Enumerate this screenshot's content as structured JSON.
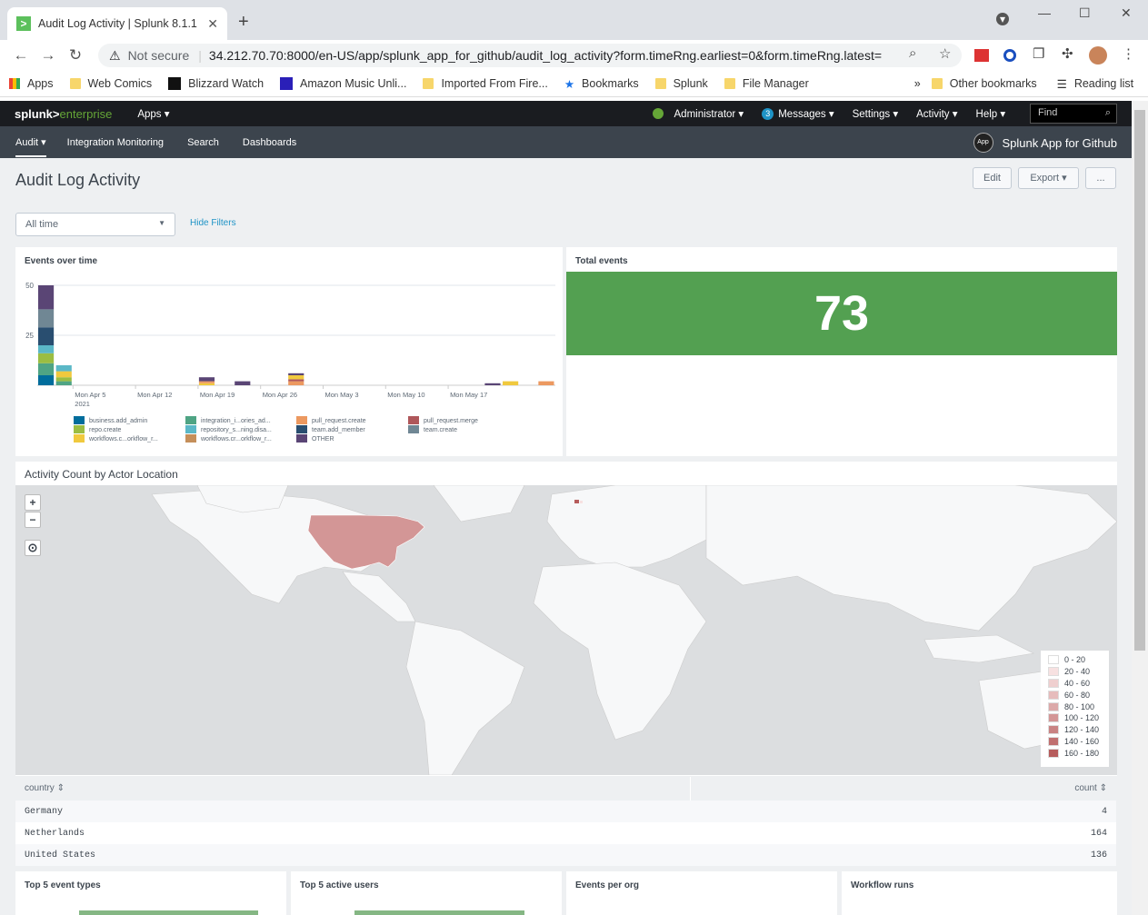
{
  "browser": {
    "tab_title": "Audit Log Activity | Splunk 8.1.1",
    "security": "Not secure",
    "url": "34.212.70.70:8000/en-US/app/splunk_app_for_github/audit_log_activity?form.timeRng.earliest=0&form.timeRng.latest=",
    "bookmarks": [
      "Apps",
      "Web Comics",
      "Blizzard Watch",
      "Amazon Music Unli...",
      "Imported From Fire...",
      "Bookmarks",
      "Splunk",
      "File Manager"
    ],
    "overflow": "»",
    "other_bookmarks": "Other bookmarks",
    "reading_list": "Reading list"
  },
  "splunk_bar": {
    "logo_a": "splunk>",
    "logo_b": "enterprise",
    "apps": "Apps ▾",
    "admin": "Administrator ▾",
    "messages_count": "3",
    "messages": "Messages ▾",
    "settings": "Settings ▾",
    "activity": "Activity ▾",
    "help": "Help ▾",
    "find": "Find"
  },
  "app_bar": {
    "items": [
      "Audit ▾",
      "Integration Monitoring",
      "Search",
      "Dashboards"
    ],
    "app_icon": "App",
    "app_name": "Splunk App for Github"
  },
  "dashboard": {
    "title": "Audit Log Activity",
    "edit": "Edit",
    "export": "Export ▾",
    "more": "...",
    "time_picker": "All time",
    "hide_filters": "Hide Filters"
  },
  "panels": {
    "events_over_time": "Events over time",
    "total_events": "Total events",
    "total_events_value": "73",
    "map_title": "Activity Count by Actor Location",
    "top5_types": "Top 5 event types",
    "top5_users": "Top 5 active users",
    "events_per_org": "Events per org",
    "workflow_runs": "Workflow runs"
  },
  "chart_data": {
    "type": "bar",
    "title": "Events over time",
    "ylim": [
      0,
      50
    ],
    "y_ticks": [
      "50",
      "25"
    ],
    "x_ticks": [
      "Mon Apr 5",
      "Mon Apr 12",
      "Mon Apr 19",
      "Mon Apr 26",
      "Mon May 3",
      "Mon May 10",
      "Mon May 17"
    ],
    "x_sub": "2021",
    "legend": [
      {
        "name": "business.add_admin",
        "color": "#006d9c"
      },
      {
        "name": "repo.create",
        "color": "#9bbd42"
      },
      {
        "name": "workflows.c...orkflow_r...",
        "color": "#f0c93e"
      },
      {
        "name": "integration_i...ories_ad...",
        "color": "#4fa484"
      },
      {
        "name": "repository_s...ning.disa...",
        "color": "#5bb8c7"
      },
      {
        "name": "workflows.cr...orkflow_r...",
        "color": "#c58f5a"
      },
      {
        "name": "pull_request.create",
        "color": "#ec9960"
      },
      {
        "name": "team.add_member",
        "color": "#294e70"
      },
      {
        "name": "OTHER",
        "color": "#5a4575"
      },
      {
        "name": "pull_request.merge",
        "color": "#af575a"
      },
      {
        "name": "team.create",
        "color": "#708794"
      }
    ],
    "bars": [
      {
        "x": 0,
        "stack": [
          [
            5,
            "#006d9c"
          ],
          [
            6,
            "#4fa484"
          ],
          [
            5,
            "#9bbd42"
          ],
          [
            4,
            "#5bb8c7"
          ],
          [
            9,
            "#294e70"
          ],
          [
            9,
            "#708794"
          ],
          [
            12,
            "#5a4575"
          ]
        ]
      },
      {
        "x": 1,
        "stack": [
          [
            2,
            "#4fa484"
          ],
          [
            2,
            "#9bbd42"
          ],
          [
            3,
            "#f0c93e"
          ],
          [
            3,
            "#5bb8c7"
          ]
        ]
      },
      {
        "x": 9,
        "stack": [
          [
            1,
            "#f0c93e"
          ],
          [
            1,
            "#ec9960"
          ],
          [
            2,
            "#5a4575"
          ]
        ]
      },
      {
        "x": 11,
        "stack": [
          [
            2,
            "#5a4575"
          ]
        ]
      },
      {
        "x": 14,
        "stack": [
          [
            2,
            "#ec9960"
          ],
          [
            1,
            "#af575a"
          ],
          [
            2,
            "#f0c93e"
          ],
          [
            1,
            "#5a4575"
          ]
        ]
      },
      {
        "x": 25,
        "stack": [
          [
            1,
            "#5a4575"
          ]
        ]
      },
      {
        "x": 26,
        "stack": [
          [
            2,
            "#f0c93e"
          ]
        ]
      },
      {
        "x": 28,
        "stack": [
          [
            2,
            "#ec9960"
          ]
        ]
      }
    ]
  },
  "map": {
    "zoom_in": "+",
    "zoom_out": "−",
    "locate": "⊙",
    "legend": [
      {
        "label": "0 - 20",
        "color": "#ffffff"
      },
      {
        "label": "20 - 40",
        "color": "#f7e1e1"
      },
      {
        "label": "40 - 60",
        "color": "#efcfcf"
      },
      {
        "label": "60 - 80",
        "color": "#e6bcbc"
      },
      {
        "label": "80 - 100",
        "color": "#dca9a9"
      },
      {
        "label": "100 - 120",
        "color": "#d39696"
      },
      {
        "label": "120 - 140",
        "color": "#c98383"
      },
      {
        "label": "140 - 160",
        "color": "#c07070"
      },
      {
        "label": "160 - 180",
        "color": "#b65c5c"
      }
    ]
  },
  "table": {
    "col_country": "country ⇕",
    "col_count": "count ⇕",
    "rows": [
      {
        "country": "Germany",
        "count": "4"
      },
      {
        "country": "Netherlands",
        "count": "164"
      },
      {
        "country": "United States",
        "count": "136"
      }
    ]
  }
}
